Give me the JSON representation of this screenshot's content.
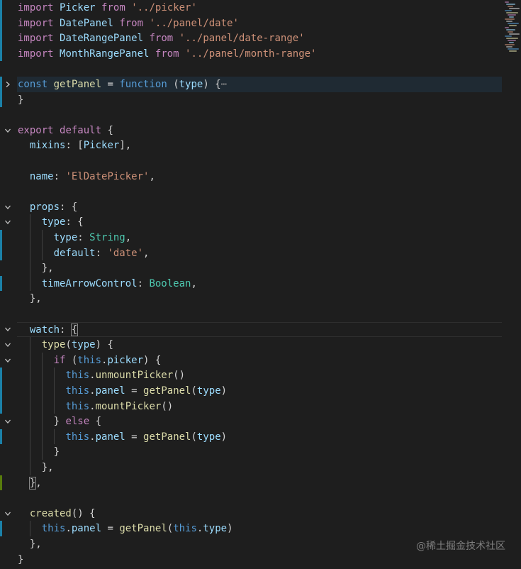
{
  "editor": {
    "theme_colors": {
      "background": "#1e1e1e",
      "keyword": "#c586c0",
      "storage": "#569cd6",
      "string": "#ce9178",
      "function": "#dcdcaa",
      "variable": "#9cdcfe",
      "type": "#4ec9b0",
      "punctuation": "#d4d4d4",
      "modified_bar": "#1b81a8"
    },
    "lines": [
      [
        [
          "kw",
          "import"
        ],
        [
          "pun",
          " "
        ],
        [
          "var",
          "Picker"
        ],
        [
          "pun",
          " "
        ],
        [
          "kw",
          "from"
        ],
        [
          "pun",
          " "
        ],
        [
          "str",
          "'../picker'"
        ]
      ],
      [
        [
          "kw",
          "import"
        ],
        [
          "pun",
          " "
        ],
        [
          "var",
          "DatePanel"
        ],
        [
          "pun",
          " "
        ],
        [
          "kw",
          "from"
        ],
        [
          "pun",
          " "
        ],
        [
          "str",
          "'../panel/date'"
        ]
      ],
      [
        [
          "kw",
          "import"
        ],
        [
          "pun",
          " "
        ],
        [
          "var",
          "DateRangePanel"
        ],
        [
          "pun",
          " "
        ],
        [
          "kw",
          "from"
        ],
        [
          "pun",
          " "
        ],
        [
          "str",
          "'../panel/date-range'"
        ]
      ],
      [
        [
          "kw",
          "import"
        ],
        [
          "pun",
          " "
        ],
        [
          "var",
          "MonthRangePanel"
        ],
        [
          "pun",
          " "
        ],
        [
          "kw",
          "from"
        ],
        [
          "pun",
          " "
        ],
        [
          "str",
          "'../panel/month-range'"
        ]
      ],
      [],
      [
        [
          "st",
          "const"
        ],
        [
          "pun",
          " "
        ],
        [
          "fn",
          "getPanel"
        ],
        [
          "pun",
          " = "
        ],
        [
          "st",
          "function"
        ],
        [
          "pun",
          " ("
        ],
        [
          "var",
          "type"
        ],
        [
          "pun",
          ") {"
        ],
        [
          "ell",
          "⋯"
        ]
      ],
      [
        [
          "pun",
          "}"
        ]
      ],
      [],
      [
        [
          "kw",
          "export"
        ],
        [
          "pun",
          " "
        ],
        [
          "kw",
          "default"
        ],
        [
          "pun",
          " {"
        ]
      ],
      [
        [
          "pun",
          "  "
        ],
        [
          "var",
          "mixins"
        ],
        [
          "pun",
          ": ["
        ],
        [
          "var",
          "Picker"
        ],
        [
          "pun",
          "],"
        ]
      ],
      [],
      [
        [
          "pun",
          "  "
        ],
        [
          "var",
          "name"
        ],
        [
          "pun",
          ": "
        ],
        [
          "str",
          "'ElDatePicker'"
        ],
        [
          "pun",
          ","
        ]
      ],
      [],
      [
        [
          "pun",
          "  "
        ],
        [
          "var",
          "props"
        ],
        [
          "pun",
          ": {"
        ]
      ],
      [
        [
          "pun",
          "    "
        ],
        [
          "var",
          "type"
        ],
        [
          "pun",
          ": {"
        ]
      ],
      [
        [
          "pun",
          "      "
        ],
        [
          "var",
          "type"
        ],
        [
          "pun",
          ": "
        ],
        [
          "type",
          "String"
        ],
        [
          "pun",
          ","
        ]
      ],
      [
        [
          "pun",
          "      "
        ],
        [
          "var",
          "default"
        ],
        [
          "pun",
          ": "
        ],
        [
          "str",
          "'date'"
        ],
        [
          "pun",
          ","
        ]
      ],
      [
        [
          "pun",
          "    },"
        ]
      ],
      [
        [
          "pun",
          "    "
        ],
        [
          "var",
          "timeArrowControl"
        ],
        [
          "pun",
          ": "
        ],
        [
          "type",
          "Boolean"
        ],
        [
          "pun",
          ","
        ]
      ],
      [
        [
          "pun",
          "  },"
        ]
      ],
      [],
      [
        [
          "pun",
          "  "
        ],
        [
          "var",
          "watch"
        ],
        [
          "pun",
          ": "
        ],
        [
          "bm",
          "{"
        ]
      ],
      [
        [
          "pun",
          "    "
        ],
        [
          "fn",
          "type"
        ],
        [
          "pun",
          "("
        ],
        [
          "var",
          "type"
        ],
        [
          "pun",
          ") {"
        ]
      ],
      [
        [
          "pun",
          "      "
        ],
        [
          "kw",
          "if"
        ],
        [
          "pun",
          " ("
        ],
        [
          "st",
          "this"
        ],
        [
          "pun",
          "."
        ],
        [
          "var",
          "picker"
        ],
        [
          "pun",
          ") {"
        ]
      ],
      [
        [
          "pun",
          "        "
        ],
        [
          "st",
          "this"
        ],
        [
          "pun",
          "."
        ],
        [
          "fn",
          "unmountPicker"
        ],
        [
          "pun",
          "()"
        ]
      ],
      [
        [
          "pun",
          "        "
        ],
        [
          "st",
          "this"
        ],
        [
          "pun",
          "."
        ],
        [
          "var",
          "panel"
        ],
        [
          "pun",
          " = "
        ],
        [
          "fn",
          "getPanel"
        ],
        [
          "pun",
          "("
        ],
        [
          "var",
          "type"
        ],
        [
          "pun",
          ")"
        ]
      ],
      [
        [
          "pun",
          "        "
        ],
        [
          "st",
          "this"
        ],
        [
          "pun",
          "."
        ],
        [
          "fn",
          "mountPicker"
        ],
        [
          "pun",
          "()"
        ]
      ],
      [
        [
          "pun",
          "      } "
        ],
        [
          "kw",
          "else"
        ],
        [
          "pun",
          " {"
        ]
      ],
      [
        [
          "pun",
          "        "
        ],
        [
          "st",
          "this"
        ],
        [
          "pun",
          "."
        ],
        [
          "var",
          "panel"
        ],
        [
          "pun",
          " = "
        ],
        [
          "fn",
          "getPanel"
        ],
        [
          "pun",
          "("
        ],
        [
          "var",
          "type"
        ],
        [
          "pun",
          ")"
        ]
      ],
      [
        [
          "pun",
          "      }"
        ]
      ],
      [
        [
          "pun",
          "    },"
        ]
      ],
      [
        [
          "pun",
          "  "
        ],
        [
          "bm",
          "}"
        ],
        [
          "pun",
          ","
        ]
      ],
      [],
      [
        [
          "pun",
          "  "
        ],
        [
          "fn",
          "created"
        ],
        [
          "pun",
          "() {"
        ]
      ],
      [
        [
          "pun",
          "    "
        ],
        [
          "st",
          "this"
        ],
        [
          "pun",
          "."
        ],
        [
          "var",
          "panel"
        ],
        [
          "pun",
          " = "
        ],
        [
          "fn",
          "getPanel"
        ],
        [
          "pun",
          "("
        ],
        [
          "st",
          "this"
        ],
        [
          "pun",
          "."
        ],
        [
          "var",
          "type"
        ],
        [
          "pun",
          ")"
        ]
      ],
      [
        [
          "pun",
          "  },"
        ]
      ],
      [
        [
          "pun",
          "}"
        ]
      ]
    ],
    "fold_markers": [
      {
        "line": 5,
        "state": "collapsed"
      },
      {
        "line": 8,
        "state": "expanded"
      },
      {
        "line": 13,
        "state": "expanded"
      },
      {
        "line": 14,
        "state": "expanded"
      },
      {
        "line": 21,
        "state": "expanded"
      },
      {
        "line": 22,
        "state": "expanded"
      },
      {
        "line": 23,
        "state": "expanded"
      },
      {
        "line": 27,
        "state": "expanded"
      },
      {
        "line": 33,
        "state": "expanded"
      }
    ],
    "modified_lines": [
      0,
      1,
      2,
      3,
      5,
      6,
      15,
      16,
      18,
      24,
      25,
      26,
      28,
      34
    ],
    "added_lines": [
      31
    ],
    "active_line": 5,
    "cursor_line": 21
  },
  "watermark": {
    "text": "@稀土掘金技术社区"
  }
}
